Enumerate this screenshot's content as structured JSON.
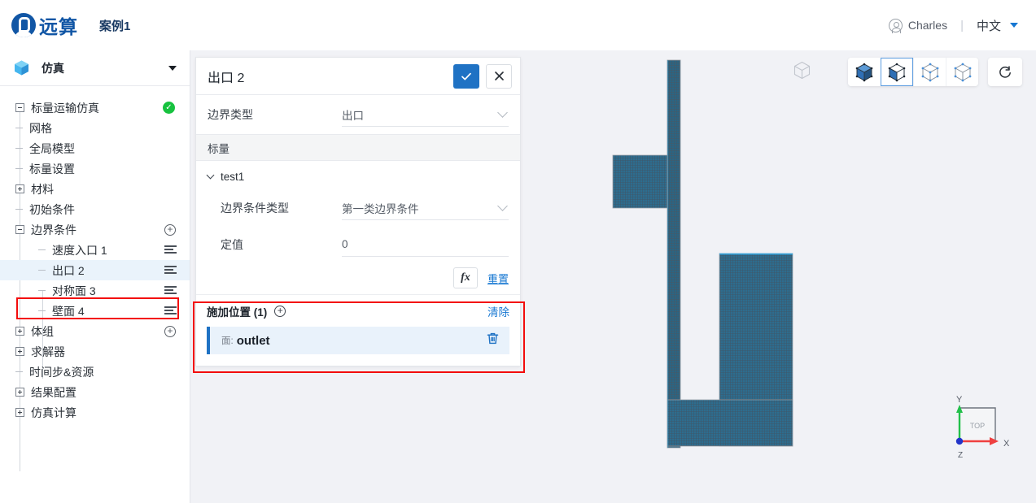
{
  "topbar": {
    "brand": "远算",
    "case_title": "案例1",
    "user_name": "Charles",
    "separator": "|",
    "language": "中文",
    "user_icon": "user-circle-icon",
    "caret_icon": "chevron-down-icon"
  },
  "sidebar": {
    "header": {
      "label": "仿真",
      "icon": "cube-icon",
      "caret": "chevron-down-icon"
    },
    "tree": [
      {
        "label": "标量运输仿真",
        "toggle": "minus",
        "badge": "check"
      },
      {
        "label": "网格",
        "toggle": "stub"
      },
      {
        "label": "全局模型",
        "toggle": "stub"
      },
      {
        "label": "标量设置",
        "toggle": "stub"
      },
      {
        "label": "材料",
        "toggle": "plus"
      },
      {
        "label": "初始条件",
        "toggle": "stub"
      },
      {
        "label": "边界条件",
        "toggle": "minus",
        "action": "plus"
      },
      {
        "label": "速度入口 1",
        "toggle": "stub",
        "action": "list",
        "depth": 2
      },
      {
        "label": "出口 2",
        "toggle": "stub",
        "action": "list",
        "depth": 2,
        "selected": true
      },
      {
        "label": "对称面 3",
        "toggle": "stub",
        "action": "list",
        "depth": 2
      },
      {
        "label": "壁面 4",
        "toggle": "stub",
        "action": "list",
        "depth": 2
      },
      {
        "label": "体组",
        "toggle": "plus",
        "action": "plus"
      },
      {
        "label": "求解器",
        "toggle": "plus"
      },
      {
        "label": "时间步&资源",
        "toggle": "stub"
      },
      {
        "label": "结果配置",
        "toggle": "plus"
      },
      {
        "label": "仿真计算",
        "toggle": "plus"
      }
    ]
  },
  "panel": {
    "title": "出口 2",
    "confirm_icon": "check-icon",
    "cancel_icon": "close-icon",
    "boundary_type": {
      "label": "边界类型",
      "value": "出口",
      "chevron": "chevron-down-icon"
    },
    "scalar_section": "标量",
    "group": {
      "label": "test1",
      "chevron": "chevron-down-icon"
    },
    "bc_type": {
      "label": "边界条件类型",
      "value": "第一类边界条件",
      "chevron": "chevron-down-icon"
    },
    "fixed_value": {
      "label": "定值",
      "value": "0"
    },
    "fx_label": "fx",
    "reset_label": "重置",
    "location": {
      "title": "施加位置 (1)",
      "add_icon": "plus-circle-icon",
      "clear_label": "清除",
      "items": [
        {
          "kind": "面:",
          "name": "outlet",
          "delete_icon": "trash-icon"
        }
      ]
    }
  },
  "viewport": {
    "toolbar": [
      {
        "name": "ghost-cube-icon",
        "active": false,
        "style": "ghost"
      },
      {
        "name": "cube-solid-icon",
        "active": false,
        "style": "solid"
      },
      {
        "name": "cube-shaded-icon",
        "active": true,
        "style": "shaded"
      },
      {
        "name": "cube-wireframe-points-icon",
        "active": false,
        "style": "wire-points"
      },
      {
        "name": "cube-wireframe-icon",
        "active": false,
        "style": "wire"
      },
      {
        "name": "reset-view-icon",
        "active": false,
        "style": "reset"
      }
    ],
    "axis": {
      "x": "X",
      "y": "Y",
      "face": "TOP"
    },
    "mesh_color": "#2d6d8f",
    "background": "#f1f2f6"
  },
  "colors": {
    "accent": "#1f72c4",
    "link": "#1677d2",
    "brand": "#1156a5",
    "highlight": "#f30c0c",
    "success": "#17c23f",
    "selection_bg": "#e9f2fb"
  }
}
